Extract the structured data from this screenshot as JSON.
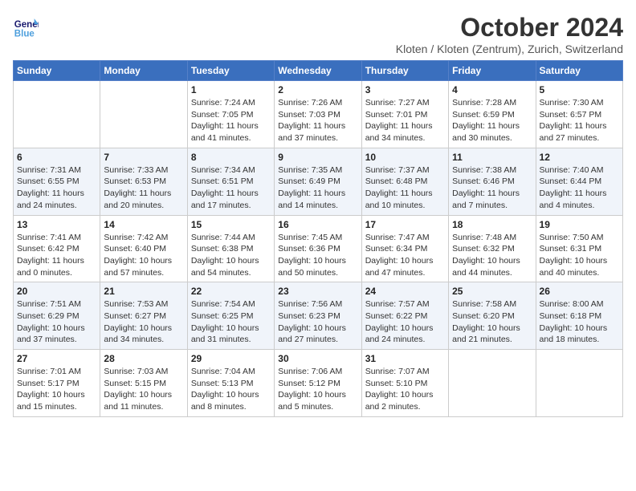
{
  "header": {
    "logo_line1": "General",
    "logo_line2": "Blue",
    "month": "October 2024",
    "location": "Kloten / Kloten (Zentrum), Zurich, Switzerland"
  },
  "weekdays": [
    "Sunday",
    "Monday",
    "Tuesday",
    "Wednesday",
    "Thursday",
    "Friday",
    "Saturday"
  ],
  "weeks": [
    [
      {
        "day": "",
        "detail": ""
      },
      {
        "day": "",
        "detail": ""
      },
      {
        "day": "1",
        "detail": "Sunrise: 7:24 AM\nSunset: 7:05 PM\nDaylight: 11 hours and 41 minutes."
      },
      {
        "day": "2",
        "detail": "Sunrise: 7:26 AM\nSunset: 7:03 PM\nDaylight: 11 hours and 37 minutes."
      },
      {
        "day": "3",
        "detail": "Sunrise: 7:27 AM\nSunset: 7:01 PM\nDaylight: 11 hours and 34 minutes."
      },
      {
        "day": "4",
        "detail": "Sunrise: 7:28 AM\nSunset: 6:59 PM\nDaylight: 11 hours and 30 minutes."
      },
      {
        "day": "5",
        "detail": "Sunrise: 7:30 AM\nSunset: 6:57 PM\nDaylight: 11 hours and 27 minutes."
      }
    ],
    [
      {
        "day": "6",
        "detail": "Sunrise: 7:31 AM\nSunset: 6:55 PM\nDaylight: 11 hours and 24 minutes."
      },
      {
        "day": "7",
        "detail": "Sunrise: 7:33 AM\nSunset: 6:53 PM\nDaylight: 11 hours and 20 minutes."
      },
      {
        "day": "8",
        "detail": "Sunrise: 7:34 AM\nSunset: 6:51 PM\nDaylight: 11 hours and 17 minutes."
      },
      {
        "day": "9",
        "detail": "Sunrise: 7:35 AM\nSunset: 6:49 PM\nDaylight: 11 hours and 14 minutes."
      },
      {
        "day": "10",
        "detail": "Sunrise: 7:37 AM\nSunset: 6:48 PM\nDaylight: 11 hours and 10 minutes."
      },
      {
        "day": "11",
        "detail": "Sunrise: 7:38 AM\nSunset: 6:46 PM\nDaylight: 11 hours and 7 minutes."
      },
      {
        "day": "12",
        "detail": "Sunrise: 7:40 AM\nSunset: 6:44 PM\nDaylight: 11 hours and 4 minutes."
      }
    ],
    [
      {
        "day": "13",
        "detail": "Sunrise: 7:41 AM\nSunset: 6:42 PM\nDaylight: 11 hours and 0 minutes."
      },
      {
        "day": "14",
        "detail": "Sunrise: 7:42 AM\nSunset: 6:40 PM\nDaylight: 10 hours and 57 minutes."
      },
      {
        "day": "15",
        "detail": "Sunrise: 7:44 AM\nSunset: 6:38 PM\nDaylight: 10 hours and 54 minutes."
      },
      {
        "day": "16",
        "detail": "Sunrise: 7:45 AM\nSunset: 6:36 PM\nDaylight: 10 hours and 50 minutes."
      },
      {
        "day": "17",
        "detail": "Sunrise: 7:47 AM\nSunset: 6:34 PM\nDaylight: 10 hours and 47 minutes."
      },
      {
        "day": "18",
        "detail": "Sunrise: 7:48 AM\nSunset: 6:32 PM\nDaylight: 10 hours and 44 minutes."
      },
      {
        "day": "19",
        "detail": "Sunrise: 7:50 AM\nSunset: 6:31 PM\nDaylight: 10 hours and 40 minutes."
      }
    ],
    [
      {
        "day": "20",
        "detail": "Sunrise: 7:51 AM\nSunset: 6:29 PM\nDaylight: 10 hours and 37 minutes."
      },
      {
        "day": "21",
        "detail": "Sunrise: 7:53 AM\nSunset: 6:27 PM\nDaylight: 10 hours and 34 minutes."
      },
      {
        "day": "22",
        "detail": "Sunrise: 7:54 AM\nSunset: 6:25 PM\nDaylight: 10 hours and 31 minutes."
      },
      {
        "day": "23",
        "detail": "Sunrise: 7:56 AM\nSunset: 6:23 PM\nDaylight: 10 hours and 27 minutes."
      },
      {
        "day": "24",
        "detail": "Sunrise: 7:57 AM\nSunset: 6:22 PM\nDaylight: 10 hours and 24 minutes."
      },
      {
        "day": "25",
        "detail": "Sunrise: 7:58 AM\nSunset: 6:20 PM\nDaylight: 10 hours and 21 minutes."
      },
      {
        "day": "26",
        "detail": "Sunrise: 8:00 AM\nSunset: 6:18 PM\nDaylight: 10 hours and 18 minutes."
      }
    ],
    [
      {
        "day": "27",
        "detail": "Sunrise: 7:01 AM\nSunset: 5:17 PM\nDaylight: 10 hours and 15 minutes."
      },
      {
        "day": "28",
        "detail": "Sunrise: 7:03 AM\nSunset: 5:15 PM\nDaylight: 10 hours and 11 minutes."
      },
      {
        "day": "29",
        "detail": "Sunrise: 7:04 AM\nSunset: 5:13 PM\nDaylight: 10 hours and 8 minutes."
      },
      {
        "day": "30",
        "detail": "Sunrise: 7:06 AM\nSunset: 5:12 PM\nDaylight: 10 hours and 5 minutes."
      },
      {
        "day": "31",
        "detail": "Sunrise: 7:07 AM\nSunset: 5:10 PM\nDaylight: 10 hours and 2 minutes."
      },
      {
        "day": "",
        "detail": ""
      },
      {
        "day": "",
        "detail": ""
      }
    ]
  ]
}
